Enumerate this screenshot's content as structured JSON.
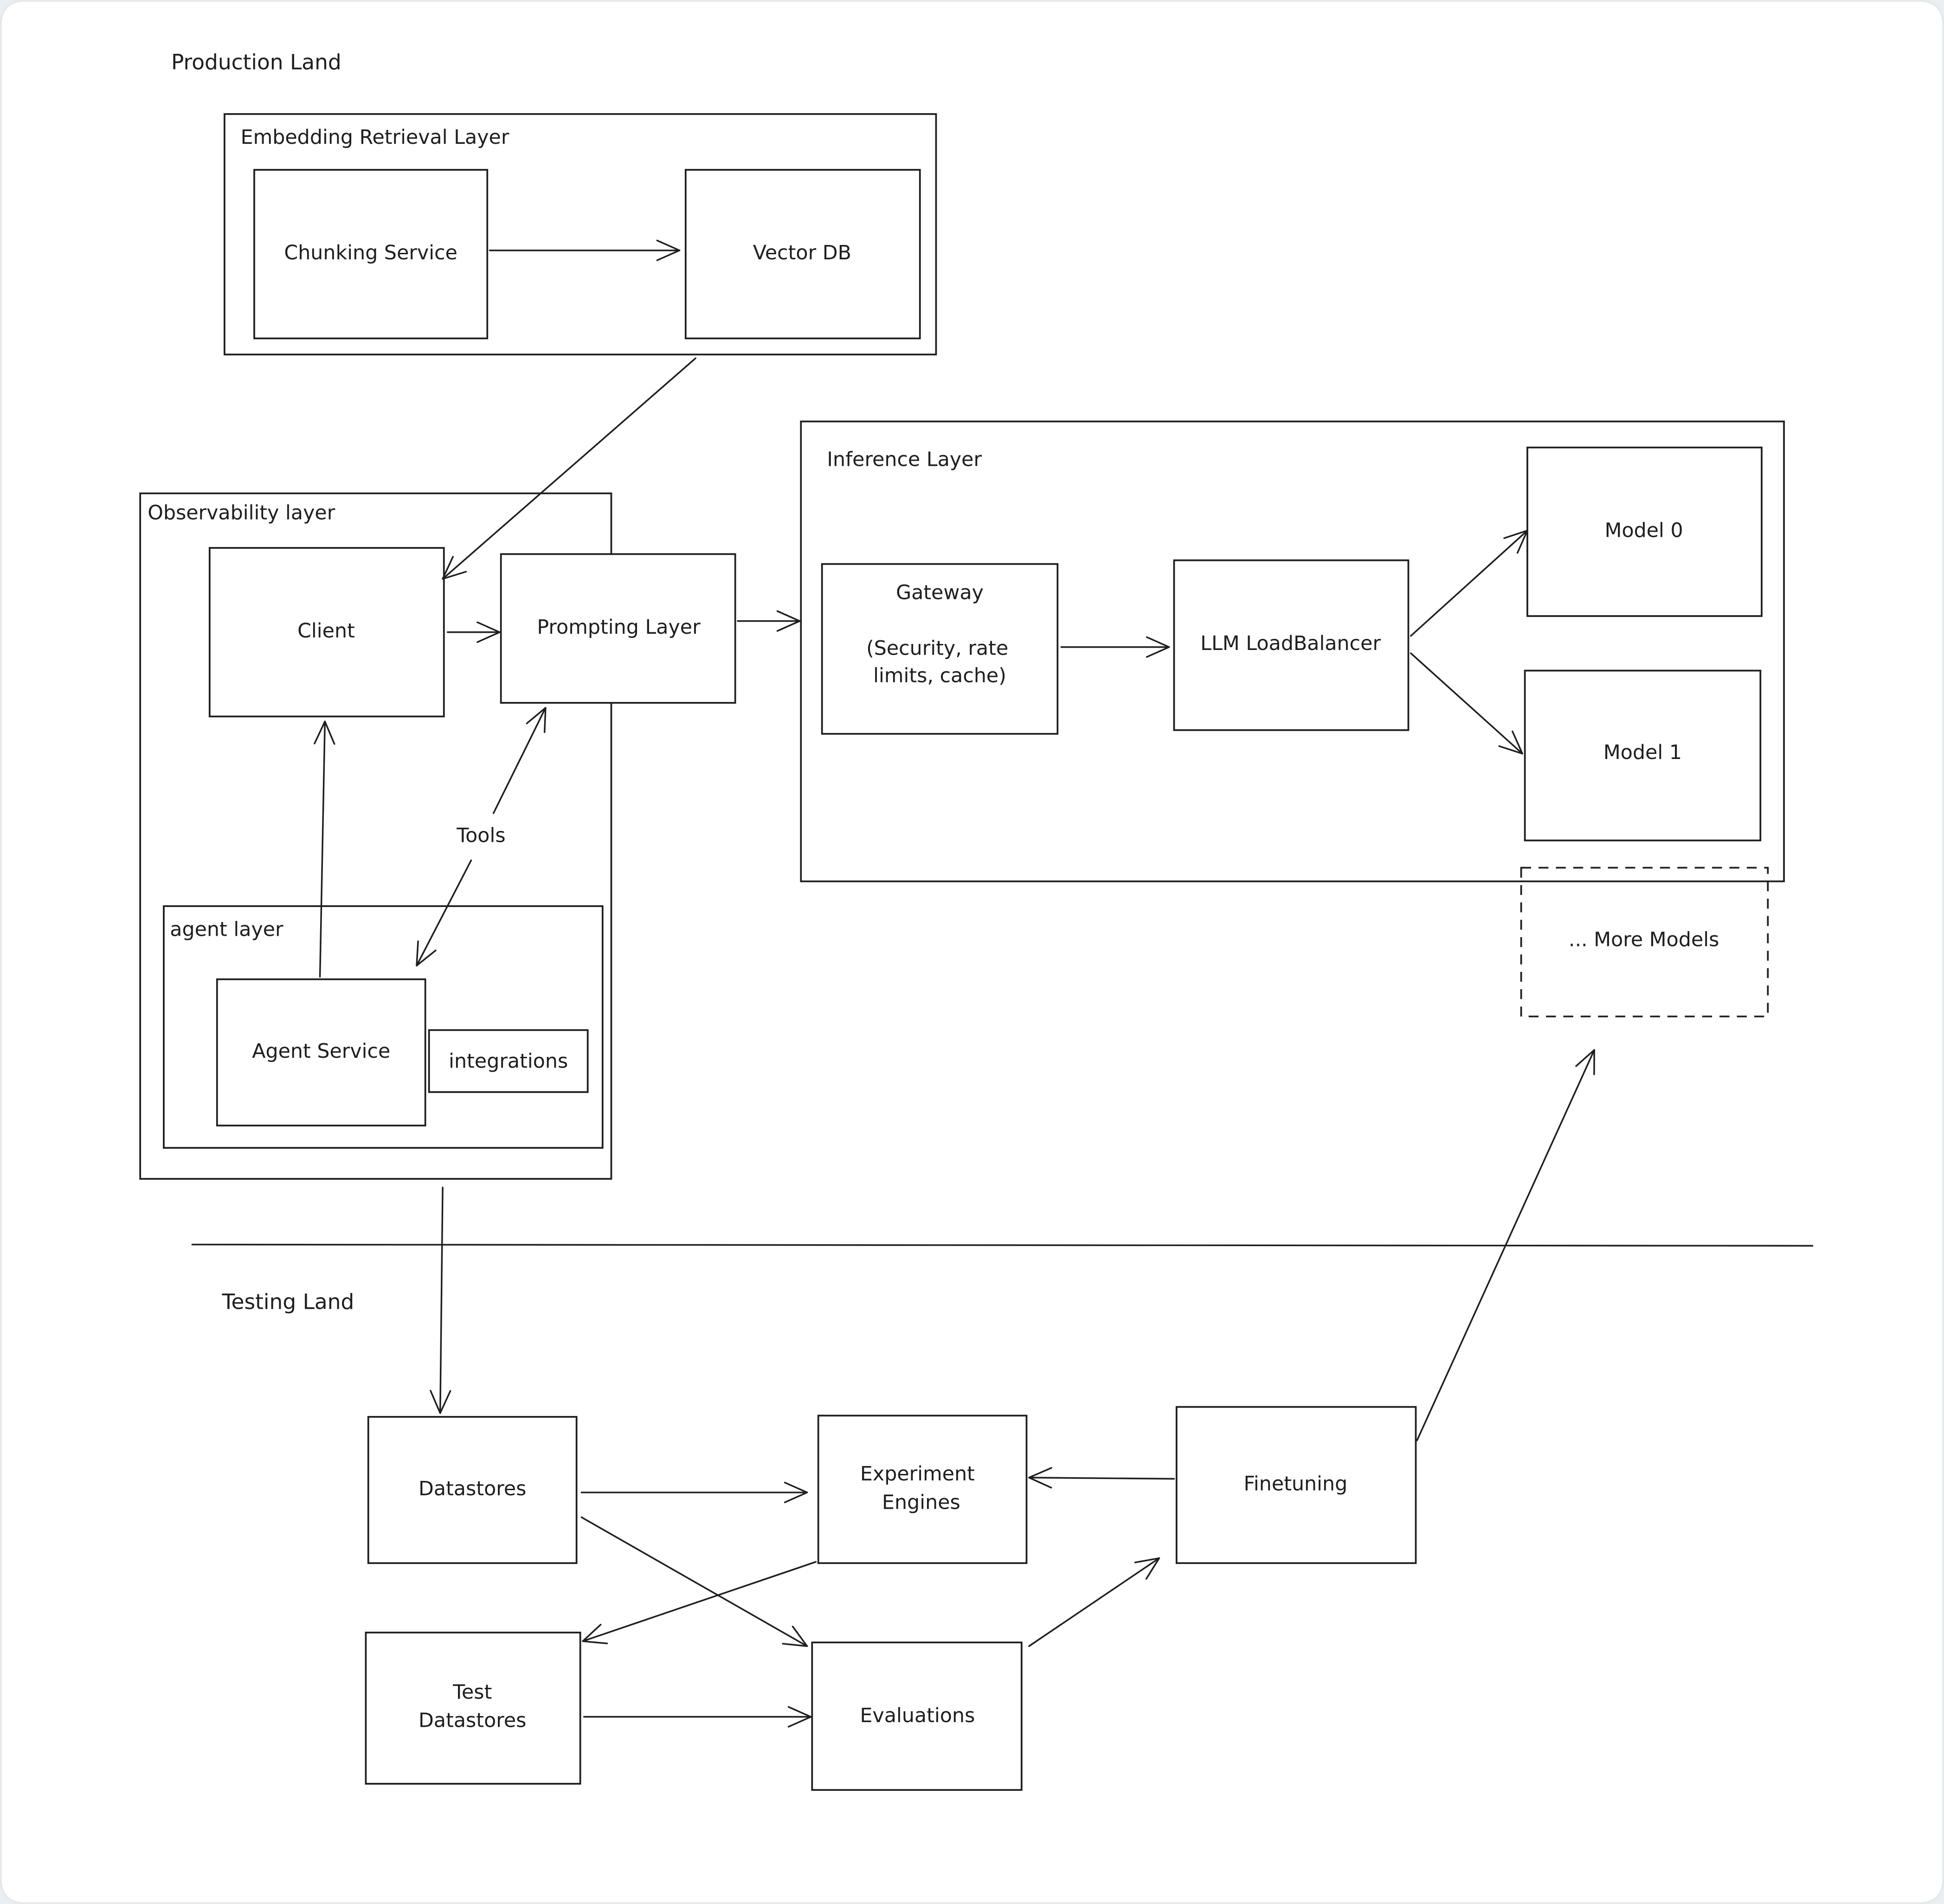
{
  "regions": {
    "production": "Production Land",
    "testing": "Testing Land"
  },
  "containers": {
    "embedding": "Embedding Retrieval Layer",
    "observability": "Observability layer",
    "agent": "agent layer",
    "inference": "Inference Layer"
  },
  "nodes": {
    "chunking": "Chunking Service",
    "vector_db": "Vector DB",
    "client": "Client",
    "prompting": "Prompting Layer",
    "agent_service": "Agent Service",
    "integrations": "integrations",
    "gateway_title": "Gateway",
    "gateway_line1": "(Security, rate",
    "gateway_line2": "limits, cache)",
    "load_balancer": "LLM LoadBalancer",
    "model0": "Model 0",
    "model1": "Model 1",
    "more_models": "... More Models",
    "datastores": "Datastores",
    "experiment_line1": "Experiment",
    "experiment_line2": "Engines",
    "finetuning": "Finetuning",
    "test_ds_line1": "Test",
    "test_ds_line2": "Datastores",
    "evaluations": "Evaluations"
  },
  "edge_labels": {
    "tools": "Tools"
  },
  "edges": [
    {
      "from": "chunking",
      "to": "vector_db"
    },
    {
      "from": "embedding",
      "to": "client"
    },
    {
      "from": "client",
      "to": "prompting"
    },
    {
      "from": "prompting",
      "to": "inference"
    },
    {
      "from": "agent_service",
      "to": "client"
    },
    {
      "from": "agent_service",
      "to": "prompting",
      "label": "Tools",
      "bidirectional": true
    },
    {
      "from": "gateway",
      "to": "load_balancer"
    },
    {
      "from": "load_balancer",
      "to": "model0"
    },
    {
      "from": "load_balancer",
      "to": "model1"
    },
    {
      "from": "observability",
      "to": "datastores"
    },
    {
      "from": "datastores",
      "to": "experiment_engines"
    },
    {
      "from": "datastores",
      "to": "evaluations"
    },
    {
      "from": "experiment_engines",
      "to": "test_datastores"
    },
    {
      "from": "test_datastores",
      "to": "evaluations"
    },
    {
      "from": "evaluations",
      "to": "finetuning"
    },
    {
      "from": "finetuning",
      "to": "experiment_engines"
    },
    {
      "from": "finetuning",
      "to": "more_models"
    }
  ]
}
